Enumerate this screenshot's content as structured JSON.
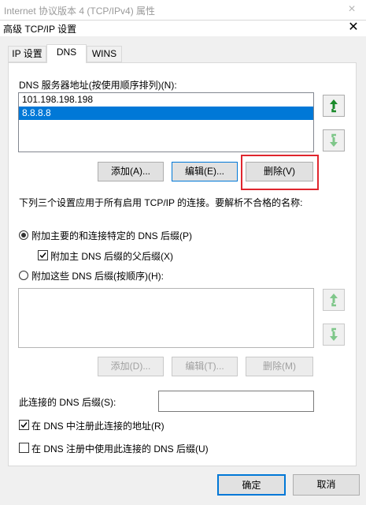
{
  "background_window": {
    "title": "Internet 协议版本 4 (TCP/IPv4) 属性",
    "close": "×"
  },
  "dialog": {
    "title": "高级 TCP/IP 设置",
    "close": "✕"
  },
  "tabs": [
    {
      "label": "IP 设置"
    },
    {
      "label": "DNS"
    },
    {
      "label": "WINS"
    }
  ],
  "dns_servers": {
    "label": "DNS 服务器地址(按使用顺序排列)(N):",
    "items": [
      {
        "address": "101.198.198.198"
      },
      {
        "address": "8.8.8.8"
      }
    ],
    "selected_index": 1,
    "buttons": {
      "add": "添加(A)...",
      "edit": "编辑(E)...",
      "remove": "删除(V)"
    }
  },
  "settings_note": "下列三个设置应用于所有启用 TCP/IP 的连接。要解析不合格的名称:",
  "options": {
    "append_primary": "附加主要的和连接特定的 DNS 后缀(P)",
    "append_parent": "附加主 DNS 后缀的父后缀(X)",
    "append_these": "附加这些 DNS 后缀(按顺序)(H):"
  },
  "suffix_buttons": {
    "add": "添加(D)...",
    "edit": "编辑(T)...",
    "remove": "删除(M)"
  },
  "connection_suffix": {
    "label": "此连接的 DNS 后缀(S):",
    "value": ""
  },
  "register": {
    "register_address": "在 DNS 中注册此连接的地址(R)",
    "use_suffix": "在 DNS 注册中使用此连接的 DNS 后缀(U)"
  },
  "footer": {
    "ok": "确定",
    "cancel": "取消"
  },
  "colors": {
    "selection": "#0078d7",
    "highlight_box": "#e0262e",
    "arrow_up_enabled": "#1a8a2a",
    "arrow_disabled": "#7fc78a"
  }
}
